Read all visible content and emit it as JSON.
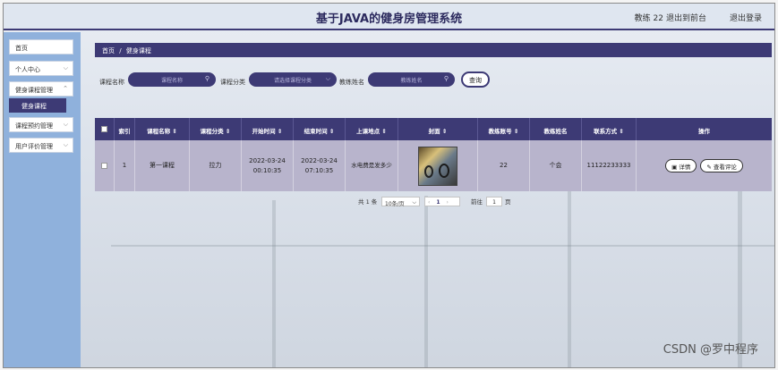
{
  "header": {
    "title": "基于JAVA的健身房管理系统",
    "user": "教练 22",
    "backend_link": "退出到前台",
    "logout_link": "退出登录"
  },
  "sidebar": {
    "items": [
      {
        "label": "首页"
      },
      {
        "label": "个人中心"
      },
      {
        "label": "健身课程管理"
      },
      {
        "label": "课程预约管理"
      },
      {
        "label": "用户评价管理"
      }
    ],
    "submenu": {
      "label": "健身课程"
    }
  },
  "breadcrumb": {
    "home": "首页",
    "sep": "/",
    "current": "健身课程"
  },
  "search": {
    "course_name_label": "课程名称",
    "course_name_placeholder": "课程名称",
    "course_type_label": "课程分类",
    "course_type_placeholder": "请选择课程分类",
    "coach_name_label": "教练姓名",
    "coach_name_placeholder": "教练姓名",
    "query_button": "查询"
  },
  "table": {
    "headers": [
      "索引",
      "课程名称 ⇕",
      "课程分类 ⇕",
      "开始时间 ⇕",
      "结束时间 ⇕",
      "上课地点 ⇕",
      "封面 ⇕",
      "教练账号 ⇕",
      "教练姓名",
      "联系方式 ⇕",
      "操作"
    ],
    "rows": [
      {
        "index": "1",
        "course_name": "第一课程",
        "course_type": "拉力",
        "start_time": "2022-03-24 00:10:35",
        "end_time": "2022-03-24 07:10:35",
        "location": "水电费是发多少",
        "coach_account": "22",
        "coach_name": "个会",
        "phone": "11122233333",
        "detail_button": "详情",
        "review_button": "查看评论"
      }
    ]
  },
  "pagination": {
    "total": "共 1 条",
    "page_size": "10条/页",
    "current_page": "1",
    "goto_label": "前往",
    "goto_value": "1",
    "page_unit": "页"
  },
  "watermark": "CSDN @罗中程序",
  "colors": {
    "accent": "#3d3a75",
    "sidebar": "#8fb1dc",
    "row": "#b8b4cc"
  }
}
